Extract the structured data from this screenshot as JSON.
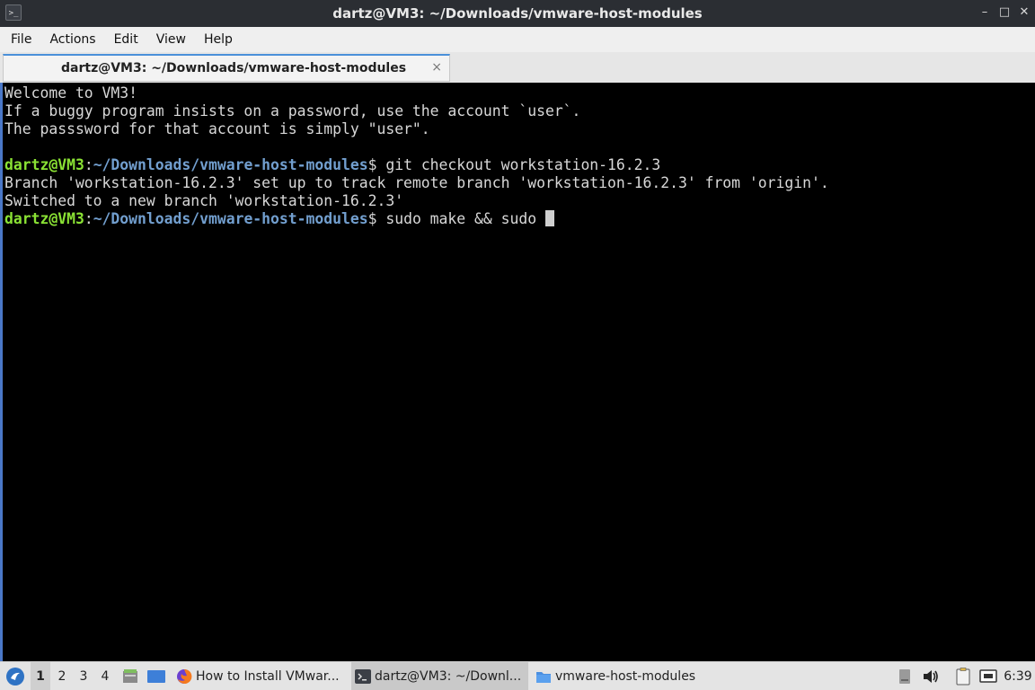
{
  "window": {
    "title": "dartz@VM3: ~/Downloads/vmware-host-modules",
    "app_icon": ">_",
    "controls": {
      "minimize": "–",
      "maximize": "□",
      "close": "✕"
    }
  },
  "menu": {
    "items": [
      "File",
      "Actions",
      "Edit",
      "View",
      "Help"
    ]
  },
  "tab": {
    "label": "dartz@VM3: ~/Downloads/vmware-host-modules",
    "close": "×"
  },
  "terminal": {
    "lines": [
      {
        "text": "Welcome to VM3!"
      },
      {
        "text": "If a buggy program insists on a password, use the account `user`."
      },
      {
        "text": "The passsword for that account is simply \"user\"."
      },
      {
        "text": ""
      },
      {
        "user": "dartz@VM3",
        "sep": ":",
        "path": "~/Downloads/vmware-host-modules",
        "cmd": "$ git checkout workstation-16.2.3"
      },
      {
        "text": "Branch 'workstation-16.2.3' set up to track remote branch 'workstation-16.2.3' from 'origin'."
      },
      {
        "text": "Switched to a new branch 'workstation-16.2.3'"
      },
      {
        "user": "dartz@VM3",
        "sep": ":",
        "path": "~/Downloads/vmware-host-modules",
        "cmd": "$ sudo make && sudo ",
        "cursor": true
      }
    ],
    "colors": {
      "user": "#8ae234",
      "path": "#729fcf",
      "text": "#d8d8d8"
    }
  },
  "taskbar": {
    "workspaces": [
      "1",
      "2",
      "3",
      "4"
    ],
    "active_workspace": "1",
    "tasks": [
      {
        "label": "How to Install VMwar...",
        "icon": "firefox-icon"
      },
      {
        "label": "dartz@VM3: ~/Downl...",
        "icon": "terminal-icon",
        "active": true
      },
      {
        "label": "vmware-host-modules",
        "icon": "folder-icon"
      }
    ],
    "clock": "6:39"
  }
}
